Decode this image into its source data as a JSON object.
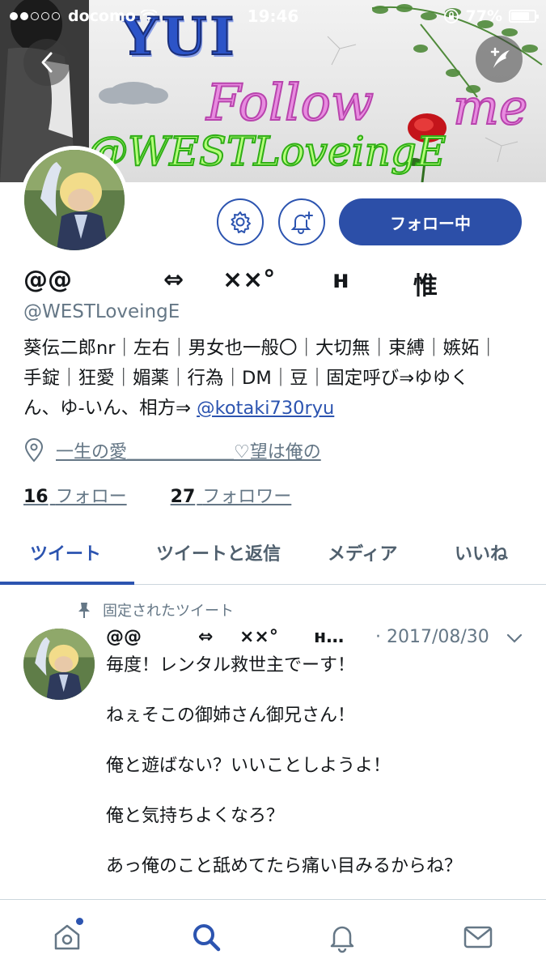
{
  "status_bar": {
    "carrier": "docomo",
    "time": "19:46",
    "battery": "77%",
    "battery_fraction": 0.77,
    "signal_dots_filled": 2,
    "signal_dots_total": 5
  },
  "banner": {
    "title": "YUI",
    "follow": "Follow",
    "me": "me",
    "handle": "@WESTLoveingE"
  },
  "profile": {
    "name_parts": [
      "@@",
      "⇔",
      "××°",
      "н",
      "惟"
    ],
    "handle": "@WESTLoveingE",
    "bio_line1": "葵伝二郎nr｜左右｜男女也一般〇｜大切無｜束縛｜嫉妬｜",
    "bio_line2": "手錠｜狂愛｜媚薬｜行為｜DM｜豆｜固定呼び⇒ゆゆく",
    "bio_line3_prefix": "ん、ゆ-いん、相方⇒ ",
    "bio_mention": "@kotaki730ryu",
    "location": "一生の愛＿＿＿＿＿＿♡望は俺の",
    "following_count": "16",
    "following_label": "フォロー",
    "followers_count": "27",
    "followers_label": "フォロワー",
    "follow_button_label": "フォロー中"
  },
  "tabs": [
    {
      "label": "ツイート",
      "active": true
    },
    {
      "label": "ツイートと返信",
      "active": false
    },
    {
      "label": "メディア",
      "active": false
    },
    {
      "label": "いいね",
      "active": false
    }
  ],
  "tweet": {
    "pinned_label": "固定されたツイート",
    "name_parts": [
      "@@",
      "⇔",
      "××°",
      "н…"
    ],
    "date": "· 2017/08/30",
    "paragraphs": [
      "毎度！レンタル救世主でーす！",
      "ねぇそこの御姉さん御兄さん！",
      "俺と遊ばない？いいことしようよ！",
      "俺と気持ちよくなろ？",
      "あっ俺のこと舐めてたら痛い目みるからね？"
    ]
  },
  "icons": {
    "back": "back-arrow-icon",
    "compose": "compose-tweet-icon",
    "settings": "gear-icon",
    "notify": "bell-plus-icon",
    "location": "location-pin-icon",
    "pin": "pin-icon",
    "caret": "chevron-down-icon",
    "nav": [
      "home-icon",
      "search-icon",
      "notifications-icon",
      "messages-icon"
    ]
  },
  "colors": {
    "accent": "#2c54b0",
    "follow_button": "#2c4fa8",
    "secondary_text": "#657786"
  }
}
